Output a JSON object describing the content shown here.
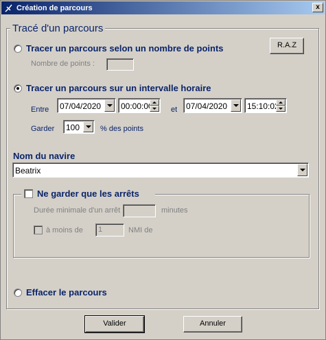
{
  "window": {
    "title": "Création de parcours",
    "close_label": "x"
  },
  "trace_group": {
    "title": "Tracé d'un parcours"
  },
  "option_points": {
    "label": "Tracer un parcours selon un nombre de points",
    "points_label": "Nombre de points :",
    "points_value": "",
    "raz_label": "R.A.Z",
    "selected": false
  },
  "option_interval": {
    "label": "Tracer un parcours sur un intervalle horaire",
    "selected": true,
    "between_label": "Entre",
    "start_date": "07/04/2020",
    "start_time": "00:00:00",
    "and_label": "et",
    "end_date": "07/04/2020",
    "end_time": "15:10:02",
    "keep_label": "Garder",
    "keep_value": "100",
    "percent_label": "% des points"
  },
  "vessel": {
    "label": "Nom du navire",
    "value": "Beatrix"
  },
  "stops_group": {
    "label": "Ne garder que les arrêts",
    "checked": false,
    "min_duration_label": "Durée minimale d'un arrêt :",
    "min_duration_value": "",
    "minutes_label": "minutes",
    "within_label": "à moins de",
    "within_value": "1",
    "nmi_label": "NMI de"
  },
  "option_clear": {
    "label": "Effacer le parcours",
    "selected": false
  },
  "buttons": {
    "ok_label": "Valider",
    "cancel_label": "Annuler"
  }
}
